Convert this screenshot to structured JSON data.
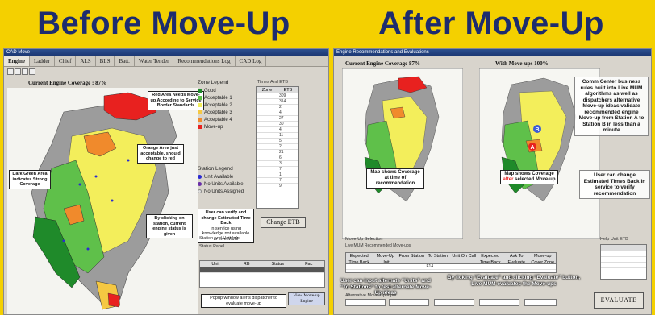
{
  "header": {
    "before_title": "Before Move-Up",
    "after_title": "After Move-Up"
  },
  "left_window": {
    "title": "CAD Move",
    "tabs": [
      "Engine",
      "Ladder",
      "Chief",
      "ALS",
      "BLS",
      "Batt.",
      "Water Tender",
      "Recommendations Log",
      "CAD Log"
    ],
    "map_title": "Current Engine Coverage : 87%",
    "zone_legend": {
      "title": "Zone Legend",
      "items": [
        {
          "label": "Good",
          "color": "#1f8a2a"
        },
        {
          "label": "Acceptable 1",
          "color": "#5fc04a"
        },
        {
          "label": "Acceptable 2",
          "color": "#f3ee5b"
        },
        {
          "label": "Acceptable 3",
          "color": "#f5c842"
        },
        {
          "label": "Acceptable 4",
          "color": "#f08a2c"
        },
        {
          "label": "Move-up",
          "color": "#e8211f"
        }
      ]
    },
    "station_legend": {
      "title": "Station Legend",
      "items": [
        {
          "label": "Unit Available",
          "color": "#2b2bd1"
        },
        {
          "label": "No Units Available",
          "color": "#6a2fa8"
        },
        {
          "label": "No Units Assigned",
          "color": "#dddddd"
        }
      ]
    },
    "etb_table": {
      "title": "Times And ETB",
      "columns": [
        "Zone",
        "ETB"
      ],
      "rows": [
        [
          "",
          "309"
        ],
        [
          "",
          "314"
        ],
        [
          "",
          "2"
        ],
        [
          "",
          "4"
        ],
        [
          "",
          "27"
        ],
        [
          "",
          "30"
        ],
        [
          "",
          "4"
        ],
        [
          "",
          "11"
        ],
        [
          "",
          "5"
        ],
        [
          "",
          "2"
        ],
        [
          "",
          "21"
        ],
        [
          "",
          "6"
        ],
        [
          "",
          "3"
        ],
        [
          "",
          "7"
        ],
        [
          "",
          "1"
        ],
        [
          "",
          "7"
        ],
        [
          "",
          "9"
        ]
      ]
    },
    "change_etb_label": "Change ETB",
    "callouts": {
      "red_area": "Red Area Needs Move-up According to Service Border Standards",
      "orange_area": "Orange Area just acceptable, should change to red",
      "dark_green": "Dark Green Area indicates Strong Coverage",
      "verify": "User can verify and change Estimated Time Back",
      "verify_sub": "In service using knowledge not available to Live MUM",
      "click_station": "By clicking on station, current engine status is given",
      "popup": "Popup window alerts dispatcher to evaluate move-up"
    },
    "station_info_title": "Station and Unit Info",
    "status_field_label": "Status Panel",
    "units_columns": [
      "Unit",
      "RB",
      "Status",
      "Fac"
    ],
    "view_moveup_label": "View Move-up Engine"
  },
  "right_window": {
    "title": "Engine Recommendations and Evaluations",
    "current_map_title": "Current Engine Coverage 87%",
    "moveup_map_title": "With Move-ups 100%",
    "current_map_caption": "Map shows Coverage at time of recommendation",
    "moveup_map_caption_pre": "Map shows Coverage",
    "moveup_map_caption_hl": "after",
    "moveup_map_caption_post": "selected Move-up",
    "comm_center_note": "Comm Center business rules built into Live MUM algorithms as well as dispatchers alternative Move-up ideas validate recommended engine Move-up from Station A to Station B in less than a minute",
    "user_change_note": "User can change Estimated Times Back in service to verify recommendation",
    "moveup_section_label": "Move-Up Selection",
    "moveup_section_sub": "Live MUM Recommended Move-ups",
    "moveup_columns": [
      "Expected Time Back",
      "Move-Up Unit",
      "From Station",
      "To Station",
      "Unit On Call",
      "Expected Time Back",
      "Ask To Evaluate",
      "Move-up Cover Zone"
    ],
    "moveup_row": [
      "",
      "",
      "",
      "F14",
      "",
      "",
      "",
      ""
    ],
    "etb_mini_title": "Help Unit ETB",
    "alt_note": "User can input alternate “Units” and “To Stations” to test alternate Move-Up ideas",
    "evaluate_note": "By ticking “Evaluate” and clicking “Evaluate” button, Live MUM evaluates the Move-ups",
    "alt_section_label": "Alternative Move-Up Input",
    "evaluate_label": "EVALUATE"
  }
}
